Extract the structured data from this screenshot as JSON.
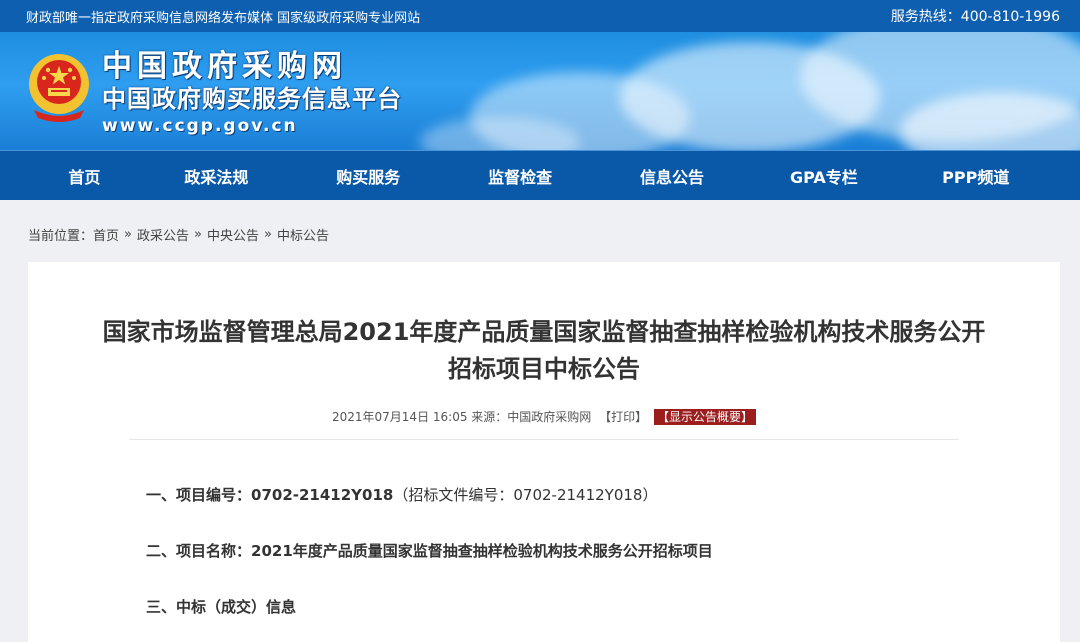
{
  "topbar": {
    "slogan": "财政部唯一指定政府采购信息网络发布媒体 国家级政府采购专业网站",
    "hotline": "服务热线：400-810-1996"
  },
  "banner": {
    "site_name": "中国政府采购网",
    "platform_name": "中国政府购买服务信息平台",
    "url": "www.ccgp.gov.cn"
  },
  "nav": {
    "items": [
      "首页",
      "政采法规",
      "购买服务",
      "监督检查",
      "信息公告",
      "GPA专栏",
      "PPP频道"
    ]
  },
  "breadcrumb": {
    "prefix": "当前位置：",
    "items": [
      "首页",
      "政采公告",
      "中央公告",
      "中标公告"
    ],
    "separator": "»"
  },
  "article": {
    "title_line1": "国家市场监督管理总局2021年度产品质量国家监督抽查抽样检验机构技术服务公开",
    "title_line2": "招标项目中标公告",
    "datetime": "2021年07月14日 16:05",
    "source": "来源：中国政府采购网",
    "print_label": "【打印】",
    "show_summary_label": "【显示公告概要】",
    "sections": [
      {
        "label": "一、项目编号：",
        "value": "0702-21412Y018",
        "note": "（招标文件编号：0702-21412Y018）"
      },
      {
        "label": "二、项目名称：",
        "value": "2021年度产品质量国家监督抽查抽样检验机构技术服务公开招标项目",
        "note": ""
      },
      {
        "label": "三、中标（成交）信息",
        "value": "",
        "note": ""
      }
    ]
  },
  "colors": {
    "topbar": "#0e5fb0",
    "nav": "#0a58a8",
    "summary_badge": "#9c1d1d"
  }
}
